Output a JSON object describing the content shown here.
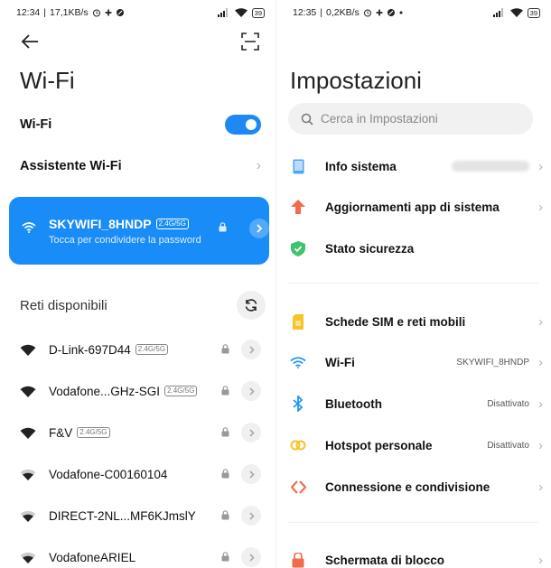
{
  "left": {
    "status": {
      "time": "12:34",
      "speed": "17,1KB/s",
      "battery": "39"
    },
    "title": "Wi-Fi",
    "wifi_toggle_label": "Wi-Fi",
    "assistant_label": "Assistente Wi-Fi",
    "connected": {
      "ssid": "SKYWIFI_8HNDP",
      "band": "2.4G/5G",
      "subtitle": "Tocca per condividere la password"
    },
    "available_title": "Reti disponibili",
    "networks": [
      {
        "name": "D-Link-697D44",
        "band": "2.4G/5G"
      },
      {
        "name": "Vodafone...GHz-SGI",
        "band": "2.4G/5G"
      },
      {
        "name": "F&V",
        "band": "2.4G/5G"
      },
      {
        "name": "Vodafone-C00160104",
        "band": ""
      },
      {
        "name": "DIRECT-2NL...MF6KJmslY",
        "band": ""
      },
      {
        "name": "VodafoneARIEL",
        "band": ""
      }
    ]
  },
  "right": {
    "status": {
      "time": "12:35",
      "speed": "0,2KB/s",
      "battery": "39"
    },
    "title": "Impostazioni",
    "search_placeholder": "Cerca in Impostazioni",
    "items": [
      {
        "label": "Info sistema",
        "value": "",
        "icon": "phone-info-icon",
        "color": "#4fa3f7"
      },
      {
        "label": "Aggiornamenti app di sistema",
        "value": "",
        "icon": "arrow-up-icon",
        "color": "#f26b4b"
      },
      {
        "label": "Stato sicurezza",
        "value": "",
        "icon": "shield-check-icon",
        "color": "#3ec46d"
      },
      {
        "label": "Schede SIM e reti mobili",
        "value": "",
        "icon": "sim-card-icon",
        "color": "#f7c325"
      },
      {
        "label": "Wi-Fi",
        "value": "SKYWIFI_8HNDP",
        "icon": "wifi-icon",
        "color": "#2196f3"
      },
      {
        "label": "Bluetooth",
        "value": "Disattivato",
        "icon": "bluetooth-icon",
        "color": "#2196f3"
      },
      {
        "label": "Hotspot personale",
        "value": "Disattivato",
        "icon": "hotspot-icon",
        "color": "#f7c325"
      },
      {
        "label": "Connessione e condivisione",
        "value": "",
        "icon": "share-icon",
        "color": "#f26b4b"
      },
      {
        "label": "Schermata di blocco",
        "value": "",
        "icon": "lock-screen-icon",
        "color": "#f26b4b"
      }
    ]
  }
}
